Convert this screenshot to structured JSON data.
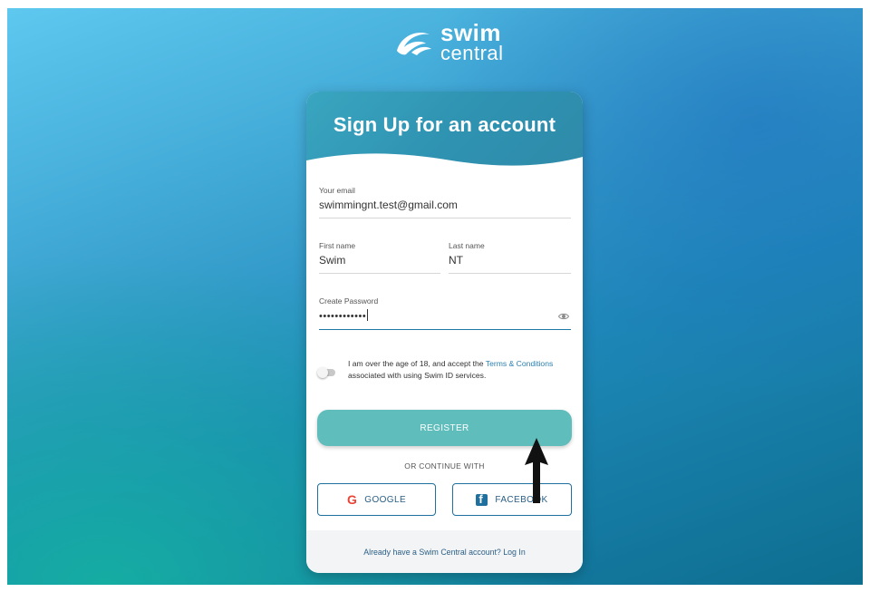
{
  "brand": {
    "logo_word1": "swim",
    "logo_word2": "central"
  },
  "card": {
    "title": "Sign Up for an account"
  },
  "form": {
    "email": {
      "label": "Your email",
      "value": "swimmingnt.test@gmail.com"
    },
    "first_name": {
      "label": "First name",
      "value": "Swim"
    },
    "last_name": {
      "label": "Last name",
      "value": "NT"
    },
    "password": {
      "label": "Create Password",
      "masked_value": "••••••••••••"
    },
    "terms": {
      "prefix": "I am over the age of 18, and accept the ",
      "link": "Terms & Conditions",
      "suffix": " associated with using Swim ID services."
    },
    "register_label": "REGISTER",
    "or_text": "OR CONTINUE WITH",
    "google_label": "GOOGLE",
    "facebook_label": "FACEBOOK",
    "footer_text": "Already have a Swim Central account? Log In"
  },
  "icons": {
    "logo": "swim-central-swirl-icon",
    "eye": "eye-icon",
    "google": "google-icon",
    "facebook": "facebook-icon",
    "annotation": "up-arrow-icon"
  },
  "colors": {
    "brand_blue": "#2f93b2",
    "register_teal": "#5fbdbc",
    "link_blue": "#2b7fb0",
    "focus_blue": "#1f77a5"
  }
}
